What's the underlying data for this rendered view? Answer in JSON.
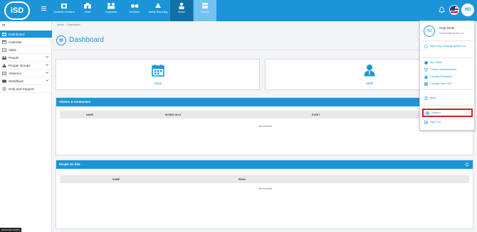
{
  "brand": {
    "logo_text": "iSD"
  },
  "modules": [
    {
      "label": "Accident / Incident",
      "icon": "first-aid-icon"
    },
    {
      "label": "Asset",
      "icon": "asset-icon"
    },
    {
      "label": "Contractor",
      "icon": "contractor-icon"
    },
    {
      "label": "Medicine",
      "icon": "medicine-icon"
    },
    {
      "label": "Safety Reporting",
      "icon": "safety-report-icon"
    },
    {
      "label": "Visitor",
      "icon": "visitor-icon"
    },
    {
      "label": "Payroll",
      "icon": "payroll-icon"
    }
  ],
  "user": {
    "initials": "HD",
    "name": "Help Desk",
    "email": "Helpdesk@ispovtet.com"
  },
  "sidebar": {
    "items": [
      {
        "label": "Dashboard",
        "icon": "dashboard-icon"
      },
      {
        "label": "Calendar",
        "icon": "calendar-icon"
      },
      {
        "label": "Visits",
        "icon": "visits-icon"
      },
      {
        "label": "People",
        "icon": "people-icon"
      },
      {
        "label": "People Groups",
        "icon": "people-groups-icon"
      },
      {
        "label": "Absence",
        "icon": "absence-icon"
      },
      {
        "label": "Workflows",
        "icon": "workflows-icon"
      },
      {
        "label": "Help and Support",
        "icon": "help-icon"
      }
    ]
  },
  "breadcrumb": {
    "root": "Visitor",
    "current": "Dashboard"
  },
  "page_title": "Dashboard",
  "cards": [
    {
      "label": "Visits",
      "icon": "calendar-icon"
    },
    {
      "label": "Staff",
      "icon": "staff-icon"
    }
  ],
  "visitors_panel": {
    "title": "Visitors & Contractors",
    "columns": [
      "NAME",
      "SIGNED IN AT",
      "EVENT"
    ],
    "empty_text": "No records"
  },
  "onsite_panel": {
    "title": "People On Site",
    "columns": [
      "NAME",
      "EMAIL"
    ],
    "empty_text": "No records"
  },
  "user_menu": {
    "link_text": "https://sgc-staging.sgsfid.com",
    "items": [
      "My Portal",
      "2 factor authentication",
      "Change Password",
      "Change User PIN",
      "Apps",
      "System",
      "Sign Out"
    ]
  },
  "status_bar": {
    "text": "javascript:void(0)"
  },
  "colors": {
    "primary": "#1b95d8",
    "highlight": "#d61f26"
  }
}
